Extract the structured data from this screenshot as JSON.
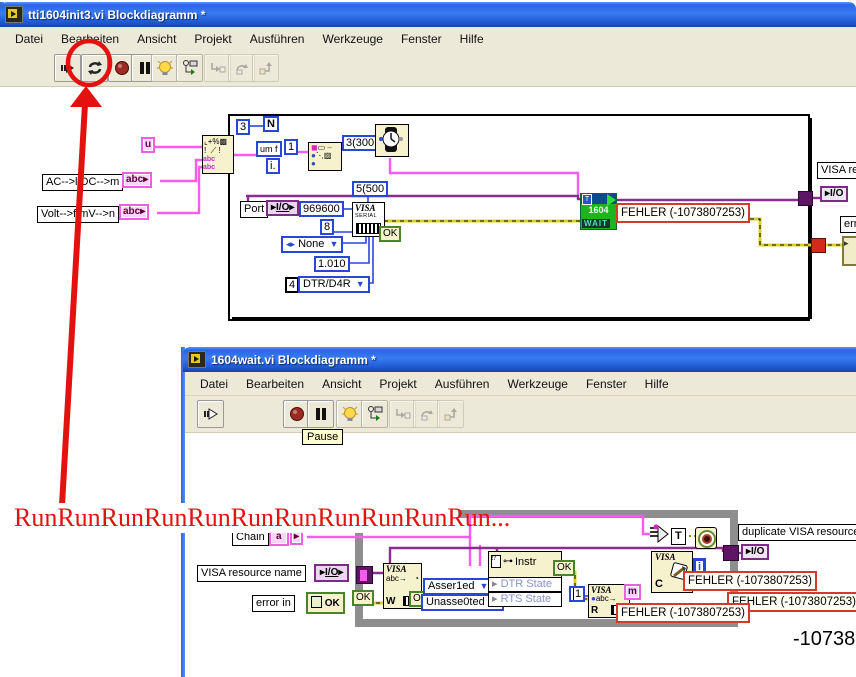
{
  "menus": [
    "Datei",
    "Bearbeiten",
    "Ansicht",
    "Projekt",
    "Ausführen",
    "Werkzeuge",
    "Fenster",
    "Hilfe"
  ],
  "common": {
    "ok": "OK",
    "io": "I/O",
    "abc": "abc",
    "visa": "VISA",
    "fehler": "FEHLER (-1073807253)"
  },
  "top": {
    "title": "tti1604init3.vi Blockdiagramm *",
    "diagram": {
      "u_const": "u",
      "ac_dc_label": "AC-->l DC-->m",
      "volt_mv_label": "Volt-->f mV-->n",
      "port_label": "Port",
      "n3_const": "3",
      "loop_n": "N",
      "wait_const": "3(300",
      "timeout_const": "5(500",
      "baud_const": "969600",
      "databits_const": "8",
      "parity_enum": "None",
      "stopbits_const": "1.010",
      "flow_num": "4",
      "flow_enum": "DTR/D4R",
      "serial_word": "SERIAL",
      "trim_box": "um f",
      "one_box": "1",
      "i_box": "i.",
      "wait_t": "T",
      "wait_num": "1604",
      "wait_word": "WAIT",
      "visa_res_label": "VISA res",
      "err_label": "err"
    }
  },
  "bottom": {
    "title": "1604wait.vi Blockdiagramm *",
    "pause_tip": "Pause",
    "diagram": {
      "chain_label": "Chain",
      "a_const": "a",
      "visa_resource_name": "VISA resource name",
      "error_in": "error in",
      "asserted_enum": "Asser1ed",
      "unasserted_enum": "Unasse0ted",
      "instr_label": "Instr",
      "dtr_state": "DTR State",
      "rts_state": "RTS State",
      "one_const": "1",
      "w_letter": "W",
      "r_letter": "R",
      "c_letter": "C",
      "abc_arrow": "abc",
      "t_const": "T",
      "i_const": "i",
      "m_label": "m",
      "duplicate_label": "duplicate VISA resource na",
      "partial_number": "-10738"
    }
  },
  "annotation": {
    "run_text": "RunRunRunRunRunRunRunRunRunRunRun..."
  },
  "colors": {
    "annotation_red": "#e41111",
    "wire_pink": "#f75bf0",
    "wire_purple": "#8a2d90",
    "wire_error_yellow": "#d9cf2a",
    "fehler_border": "#d23a2e",
    "wait_green": "#1db51d",
    "titlebar_blue": "#2767e8"
  }
}
